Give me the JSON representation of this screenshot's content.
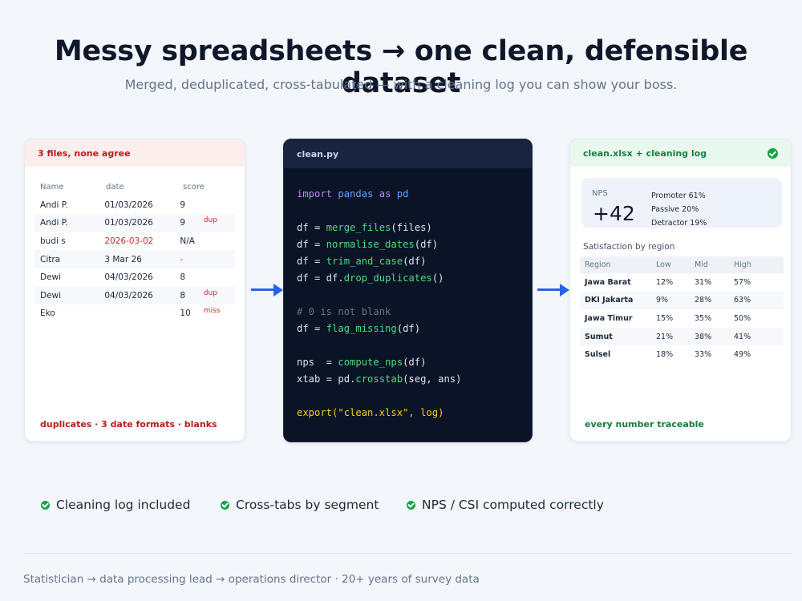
{
  "headline": "Messy spreadsheets  →  one clean, defensible dataset",
  "subline": "Merged, deduplicated, cross-tabulated — with a cleaning log you can show your boss.",
  "left_card": {
    "title": "3 files, none agree",
    "columns": [
      "Name",
      "date",
      "score"
    ],
    "rows": [
      {
        "name": "Andi P.",
        "date": "01/03/2026",
        "score": "9",
        "flag": ""
      },
      {
        "name": "Andi P.",
        "date": "01/03/2026",
        "score": "9",
        "flag": "dup"
      },
      {
        "name": "budi s",
        "date": "2026-03-02",
        "score": "N/A",
        "flag": ""
      },
      {
        "name": "Citra",
        "date": "3 Mar 26",
        "score": "-",
        "flag": ""
      },
      {
        "name": "Dewi",
        "date": "04/03/2026",
        "score": "8",
        "flag": ""
      },
      {
        "name": "Dewi",
        "date": "04/03/2026",
        "score": "8",
        "flag": "dup"
      },
      {
        "name": "Eko",
        "date": "",
        "score": "10",
        "flag": "miss"
      }
    ],
    "footer": "duplicates · 3 date formats · blanks"
  },
  "code_card": {
    "filename": "clean.py",
    "lines": [
      {
        "segments": [
          {
            "t": "import ",
            "c": "kw"
          },
          {
            "t": "pandas ",
            "c": "mod"
          },
          {
            "t": "as ",
            "c": "kw"
          },
          {
            "t": "pd",
            "c": "mod"
          }
        ]
      },
      {
        "segments": []
      },
      {
        "segments": [
          {
            "t": "df = ",
            "c": ""
          },
          {
            "t": "merge_files",
            "c": "fn"
          },
          {
            "t": "(files)",
            "c": ""
          }
        ]
      },
      {
        "segments": [
          {
            "t": "df = ",
            "c": ""
          },
          {
            "t": "normalise_dates",
            "c": "fn"
          },
          {
            "t": "(df)",
            "c": ""
          }
        ]
      },
      {
        "segments": [
          {
            "t": "df = ",
            "c": ""
          },
          {
            "t": "trim_and_case",
            "c": "fn"
          },
          {
            "t": "(df)",
            "c": ""
          }
        ]
      },
      {
        "segments": [
          {
            "t": "df = df.",
            "c": ""
          },
          {
            "t": "drop_duplicates",
            "c": "fn"
          },
          {
            "t": "()",
            "c": ""
          }
        ]
      },
      {
        "segments": []
      },
      {
        "segments": [
          {
            "t": "# 0 is not blank",
            "c": "cm"
          }
        ]
      },
      {
        "segments": [
          {
            "t": "df = ",
            "c": ""
          },
          {
            "t": "flag_missing",
            "c": "fn"
          },
          {
            "t": "(df)",
            "c": ""
          }
        ]
      },
      {
        "segments": []
      },
      {
        "segments": [
          {
            "t": "nps  = ",
            "c": ""
          },
          {
            "t": "compute_nps",
            "c": "fn"
          },
          {
            "t": "(df)",
            "c": ""
          }
        ]
      },
      {
        "segments": [
          {
            "t": "xtab = pd.",
            "c": ""
          },
          {
            "t": "crosstab",
            "c": "fn"
          },
          {
            "t": "(seg, ans)",
            "c": ""
          }
        ]
      },
      {
        "segments": []
      },
      {
        "segments": [
          {
            "t": "export(\"clean.xlsx\", log)",
            "c": "str"
          }
        ]
      }
    ]
  },
  "right_card": {
    "title": "clean.xlsx  +  cleaning log",
    "nps_label": "NPS",
    "nps_value": "+42",
    "promoter": "Promoter  61%",
    "passive": "Passive   20%",
    "detractor": "Detractor 19%",
    "sat_title": "Satisfaction by region",
    "columns": [
      "Region",
      "Low",
      "Mid",
      "High"
    ],
    "rows": [
      [
        "Jawa Barat",
        "12%",
        "31%",
        "57%"
      ],
      [
        "DKI Jakarta",
        "9%",
        "28%",
        "63%"
      ],
      [
        "Jawa Timur",
        "15%",
        "35%",
        "50%"
      ],
      [
        "Sumut",
        "21%",
        "38%",
        "41%"
      ],
      [
        "Sulsel",
        "18%",
        "33%",
        "49%"
      ]
    ],
    "footer": "every number traceable"
  },
  "benefits": [
    "Cleaning log included",
    "Cross-tabs by segment",
    "NPS / CSI computed correctly"
  ],
  "footer": "Statistician → data processing lead → operations director  ·  20+ years of survey data",
  "colors": {
    "accent": "#2563eb",
    "success": "#16a34a",
    "error": "#dc2626",
    "code_bg": "#0b1326"
  }
}
